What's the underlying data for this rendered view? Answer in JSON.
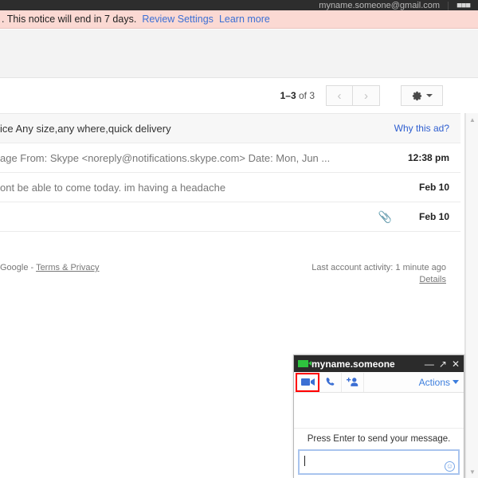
{
  "topbar": {
    "account_email": "myname.someone@gmail.com",
    "apps_icon": "apps-grid-icon"
  },
  "notice": {
    "text": ". This notice will end in 7 days.",
    "review_settings_label": "Review Settings",
    "learn_more_label": "Learn more",
    "background_color": "#fbd9d3"
  },
  "pagination": {
    "count_prefix": "1–3",
    "count_suffix": "of 3",
    "prev_label": "‹",
    "next_label": "›",
    "settings_icon": "gear-icon"
  },
  "mail_rows": [
    {
      "type": "ad",
      "snippet": "ice Any size,any where,quick delivery",
      "link_label": "Why this ad?",
      "date": "",
      "attachment": false
    },
    {
      "type": "message",
      "snippet": "age From: Skype <noreply@notifications.skype.com> Date: Mon, Jun ...",
      "link_label": "",
      "date": "12:38 pm",
      "attachment": false
    },
    {
      "type": "message",
      "snippet": "ont be able to come today. im having a headache",
      "link_label": "",
      "date": "Feb 10",
      "attachment": false
    },
    {
      "type": "message",
      "snippet": "",
      "link_label": "",
      "date": "Feb 10",
      "attachment": true
    }
  ],
  "footer": {
    "google_label": "Google -",
    "terms_label": "Terms & Privacy",
    "activity_text": "Last account activity: 1 minute ago",
    "details_label": "Details"
  },
  "scrollbar": {
    "up_arrow": "▲",
    "down_arrow": "▼"
  },
  "chat": {
    "title": "myname.someone",
    "status_icon": "video-camera-icon",
    "minimize_label": "—",
    "popout_label": "↗",
    "close_label": "✕",
    "toolbar": {
      "video_icon": "video-call-icon",
      "phone_icon": "phone-call-icon",
      "add_person_icon": "add-person-icon",
      "actions_label": "Actions"
    },
    "hint": "Press Enter to send your message.",
    "input_value": "",
    "emoji_icon": "smiley-icon",
    "highlight_color": "#ff0000"
  }
}
